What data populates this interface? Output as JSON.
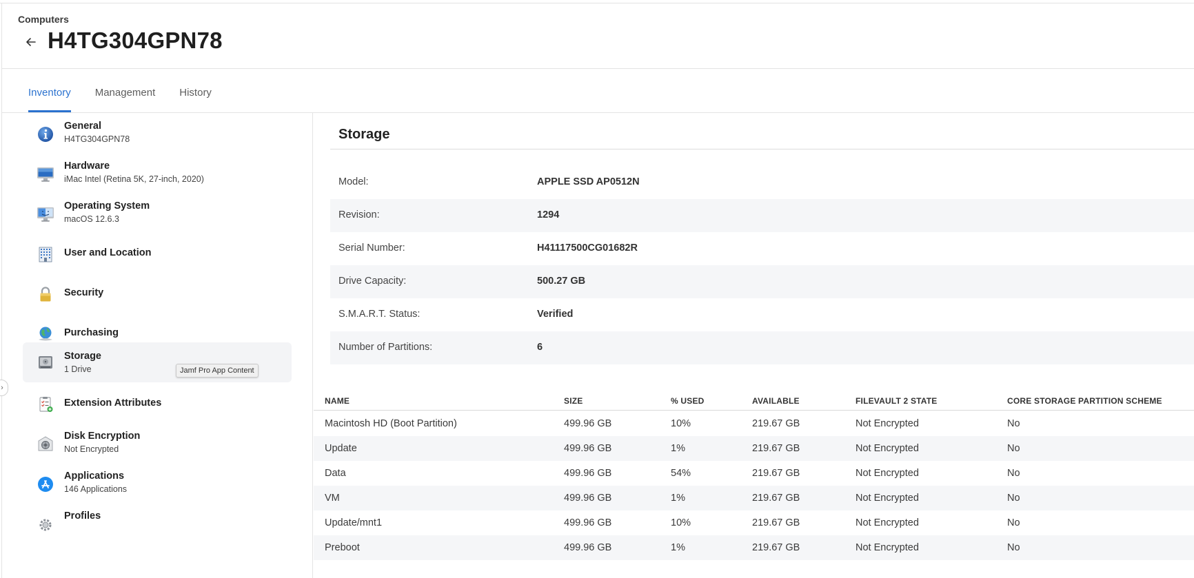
{
  "header": {
    "breadcrumb": "Computers",
    "title": "H4TG304GPN78"
  },
  "tabs": [
    {
      "label": "Inventory",
      "active": true
    },
    {
      "label": "Management",
      "active": false
    },
    {
      "label": "History",
      "active": false
    }
  ],
  "sidebar": {
    "items": [
      {
        "title": "General",
        "subtitle": "H4TG304GPN78",
        "icon": "info-icon"
      },
      {
        "title": "Hardware",
        "subtitle": "iMac Intel (Retina 5K, 27-inch, 2020)",
        "icon": "imac-icon"
      },
      {
        "title": "Operating System",
        "subtitle": "macOS 12.6.3",
        "icon": "finder-icon"
      },
      {
        "title": "User and Location",
        "subtitle": "",
        "icon": "building-icon"
      },
      {
        "title": "Security",
        "subtitle": "",
        "icon": "lock-icon"
      },
      {
        "title": "Purchasing",
        "subtitle": "",
        "icon": "globe-icon"
      },
      {
        "title": "Storage",
        "subtitle": "1 Drive",
        "icon": "drive-icon"
      },
      {
        "title": "Extension Attributes",
        "subtitle": "",
        "icon": "checklist-icon"
      },
      {
        "title": "Disk Encryption",
        "subtitle": "Not Encrypted",
        "icon": "filevault-icon"
      },
      {
        "title": "Applications",
        "subtitle": "146 Applications",
        "icon": "app-store-icon"
      },
      {
        "title": "Profiles",
        "subtitle": "",
        "icon": "gear-icon"
      }
    ],
    "tooltip": "Jamf Pro App Content",
    "collapse_glyph": "›"
  },
  "storage": {
    "title": "Storage",
    "fields": [
      {
        "label": "Model:",
        "value": "APPLE SSD AP0512N"
      },
      {
        "label": "Revision:",
        "value": "1294"
      },
      {
        "label": "Serial Number:",
        "value": "H41117500CG01682R"
      },
      {
        "label": "Drive Capacity:",
        "value": "500.27 GB"
      },
      {
        "label": "S.M.A.R.T. Status:",
        "value": "Verified"
      },
      {
        "label": "Number of Partitions:",
        "value": "6"
      }
    ],
    "table": {
      "headers": [
        "NAME",
        "SIZE",
        "% USED",
        "AVAILABLE",
        "FILEVAULT 2 STATE",
        "CORE STORAGE PARTITION SCHEME"
      ],
      "rows": [
        [
          "Macintosh HD (Boot Partition)",
          "499.96 GB",
          "10%",
          "219.67 GB",
          "Not Encrypted",
          "No"
        ],
        [
          "Update",
          "499.96 GB",
          "1%",
          "219.67 GB",
          "Not Encrypted",
          "No"
        ],
        [
          "Data",
          "499.96 GB",
          "54%",
          "219.67 GB",
          "Not Encrypted",
          "No"
        ],
        [
          "VM",
          "499.96 GB",
          "1%",
          "219.67 GB",
          "Not Encrypted",
          "No"
        ],
        [
          "Update/mnt1",
          "499.96 GB",
          "10%",
          "219.67 GB",
          "Not Encrypted",
          "No"
        ],
        [
          "Preboot",
          "499.96 GB",
          "1%",
          "219.67 GB",
          "Not Encrypted",
          "No"
        ]
      ]
    }
  },
  "colors": {
    "accent": "#2b72cf",
    "row_alt": "#f5f6f8",
    "border": "#e3e3e3"
  }
}
